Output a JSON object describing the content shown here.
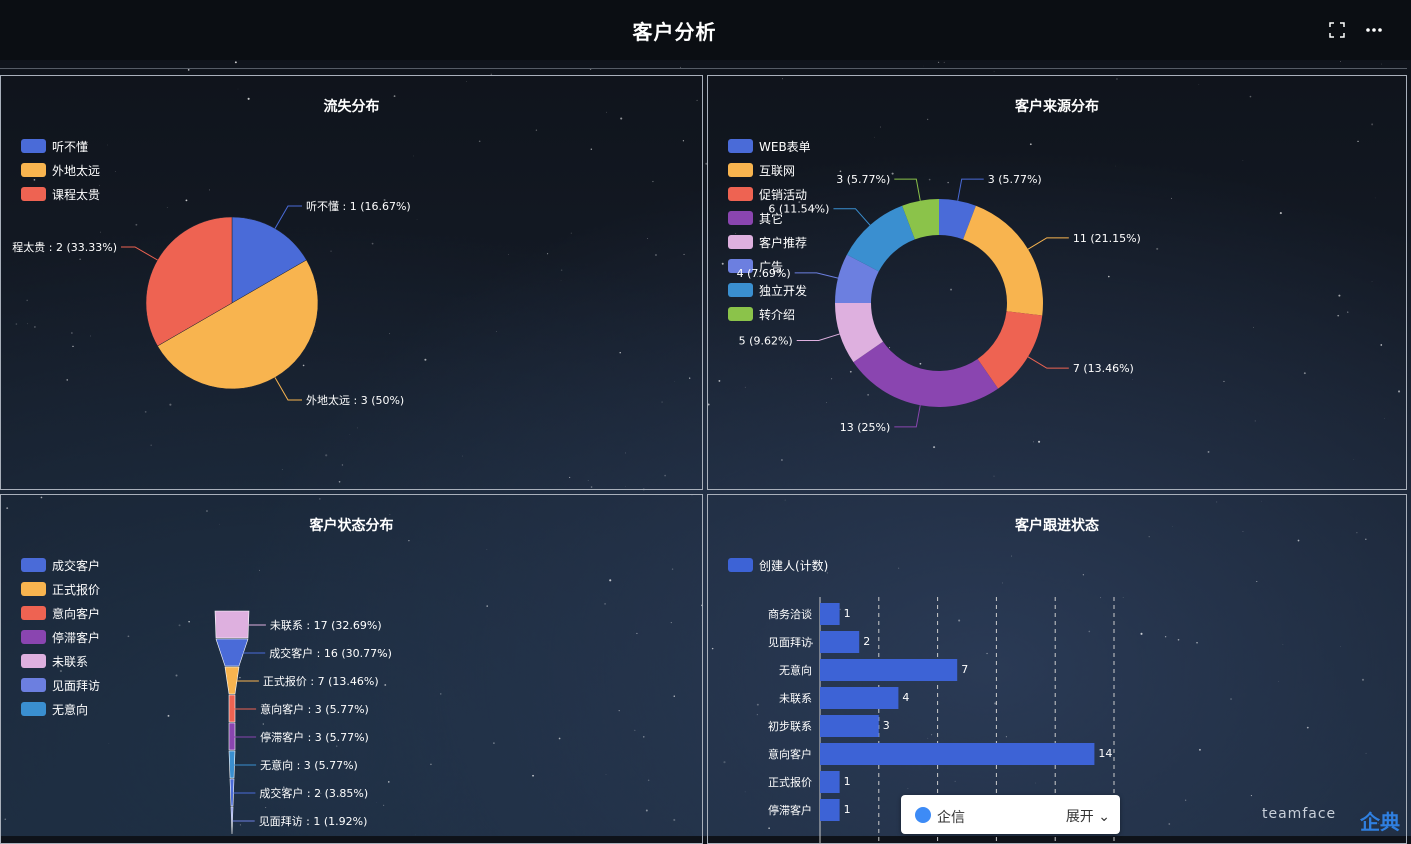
{
  "header": {
    "title": "客户分析"
  },
  "panels": {
    "churn": {
      "title": "流失分布",
      "legend": [
        {
          "name": "听不懂",
          "color": "#4a6bd8"
        },
        {
          "name": "外地太远",
          "color": "#f8b44f"
        },
        {
          "name": "课程太贵",
          "color": "#ee6352"
        }
      ]
    },
    "source": {
      "title": "客户来源分布",
      "legend": [
        {
          "name": "WEB表单",
          "color": "#4a6bd8"
        },
        {
          "name": "互联网",
          "color": "#f8b44f"
        },
        {
          "name": "促销活动",
          "color": "#ee6352"
        },
        {
          "name": "其它",
          "color": "#8a45b0"
        },
        {
          "name": "客户推荐",
          "color": "#deb0df"
        },
        {
          "name": "广告",
          "color": "#6c7fe0"
        },
        {
          "name": "独立开发",
          "color": "#3a8fd0"
        },
        {
          "name": "转介绍",
          "color": "#8bc34a"
        }
      ]
    },
    "status": {
      "title": "客户状态分布",
      "legend": [
        {
          "name": "成交客户",
          "color": "#4a6bd8"
        },
        {
          "name": "正式报价",
          "color": "#f8b44f"
        },
        {
          "name": "意向客户",
          "color": "#ee6352"
        },
        {
          "name": "停滞客户",
          "color": "#8a45b0"
        },
        {
          "name": "未联系",
          "color": "#deb0df"
        },
        {
          "name": "见面拜访",
          "color": "#6c7fe0"
        },
        {
          "name": "无意向",
          "color": "#3a8fd0"
        }
      ]
    },
    "followup": {
      "title": "客户跟进状态",
      "legend": [
        {
          "name": "创建人(计数)",
          "color": "#3d63d6"
        }
      ]
    }
  },
  "chart_data": [
    {
      "type": "pie",
      "title": "流失分布",
      "categories": [
        "听不懂",
        "外地太远",
        "课程太贵"
      ],
      "values": [
        1,
        3,
        2
      ],
      "labels": [
        "听不懂 : 1 (16.67%)",
        "外地太远 : 3 (50%)",
        "程太贵 : 2 (33.33%)"
      ],
      "colors": [
        "#4a6bd8",
        "#f8b44f",
        "#ee6352"
      ]
    },
    {
      "type": "pie",
      "subtype": "donut",
      "title": "客户来源分布",
      "categories": [
        "WEB表单",
        "互联网",
        "促销活动",
        "其它",
        "客户推荐",
        "广告",
        "独立开发",
        "转介绍"
      ],
      "values": [
        3,
        11,
        7,
        13,
        5,
        4,
        6,
        3
      ],
      "labels": [
        "3 (5.77%)",
        "11 (21.15%)",
        "7 (13.46%)",
        "13 (25%)",
        "5 (9.62%)",
        "4 (7.69%)",
        "6 (11.54%)",
        "3 (5.77%)"
      ],
      "colors": [
        "#4a6bd8",
        "#f8b44f",
        "#ee6352",
        "#8a45b0",
        "#deb0df",
        "#6c7fe0",
        "#3a8fd0",
        "#8bc34a"
      ]
    },
    {
      "type": "funnel",
      "title": "客户状态分布",
      "categories": [
        "未联系",
        "成交客户",
        "正式报价",
        "意向客户",
        "停滞客户",
        "无意向",
        "成交客户",
        "见面拜访"
      ],
      "values": [
        17,
        16,
        7,
        3,
        3,
        3,
        2,
        1
      ],
      "labels": [
        "未联系 : 17 (32.69%)",
        "成交客户 : 16 (30.77%)",
        "正式报价 : 7 (13.46%)",
        "意向客户 : 3 (5.77%)",
        "停滞客户 : 3 (5.77%)",
        "无意向 : 3 (5.77%)",
        "成交客户 : 2 (3.85%)",
        "见面拜访 : 1 (1.92%)"
      ],
      "colors": [
        "#deb0df",
        "#4a6bd8",
        "#f8b44f",
        "#ee6352",
        "#8a45b0",
        "#3a8fd0",
        "#4a6bd8",
        "#6c7fe0"
      ]
    },
    {
      "type": "bar",
      "orientation": "horizontal",
      "title": "客户跟进状态",
      "categories": [
        "商务洽谈",
        "见面拜访",
        "无意向",
        "未联系",
        "初步联系",
        "意向客户",
        "正式报价",
        "停滞客户"
      ],
      "series": [
        {
          "name": "创建人(计数)",
          "values": [
            1,
            2,
            7,
            4,
            3,
            14,
            1,
            1
          ]
        }
      ],
      "xlim": [
        0,
        15
      ],
      "color": "#3d63d6"
    }
  ],
  "chat": {
    "name": "企信",
    "expand": "展开"
  },
  "watermark": {
    "text": "teamface",
    "brand": "企典"
  }
}
